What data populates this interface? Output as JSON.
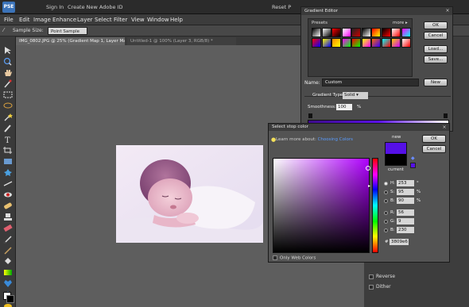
{
  "title_bar": {
    "logo": "PSE",
    "sign_in": "Sign In",
    "create_id": "Create New Adobe ID",
    "reset": "Reset P"
  },
  "menu": [
    "File",
    "Edit",
    "Image",
    "Enhance",
    "Layer",
    "Select",
    "Filter",
    "View",
    "Window",
    "Help"
  ],
  "options": {
    "sample_size_label": "Sample Size:",
    "sample_size_value": "Point Sample"
  },
  "tabs": [
    "IMG_0802.JPG @ 25% (Gradient Map 1, Layer Mask/8) *",
    "Untitled-1 @ 100% (Layer 3, RGB/8) *"
  ],
  "gradient_editor": {
    "title": "Gradient Editor",
    "presets_label": "Presets",
    "more_label": "more",
    "ok": "OK",
    "cancel": "Cancel",
    "load": "Load...",
    "save": "Save...",
    "name_label": "Name:",
    "name_value": "Custom",
    "new": "New",
    "gradient_type_label": "Gradient Type:",
    "gradient_type_value": "Solid",
    "smoothness_label": "Smoothness:",
    "smoothness_value": "100",
    "smoothness_unit": "%",
    "preset_colors": [
      [
        "#000000",
        "#ffffff"
      ],
      [
        "#ffffff",
        "#000000"
      ],
      [
        "#ff0000",
        "#000000"
      ],
      [
        "#ffffff",
        "#ff00ff"
      ],
      [
        "#222222",
        "#cc0000"
      ],
      [
        "#000000",
        "#ffffff"
      ],
      [
        "#ff0000",
        "#ffff00"
      ],
      [
        "#000000",
        "#ff0000"
      ],
      [
        "#ffffff",
        "#ff0000"
      ],
      [
        "#ff00ff",
        "#00ffff"
      ],
      [
        "#ff0000",
        "#0000ff"
      ],
      [
        "#ffff00",
        "#0000ff"
      ],
      [
        "#ff8800",
        "#ffff00"
      ],
      [
        "#ff00ff",
        "#00ff00"
      ],
      [
        "#ff0000",
        "#00ff00"
      ],
      [
        "#ffff00",
        "#ff00ff"
      ],
      [
        "#ff6600",
        "#3300ff"
      ],
      [
        "#00ffff",
        "#ff0000"
      ],
      [
        "#ffcc00",
        "#cc00ff"
      ],
      [
        "#ffffff",
        "#ff0000"
      ]
    ]
  },
  "select_stop_color": {
    "title": "Select stop color",
    "learn_prefix": "Learn more about:",
    "learn_link": "Choosing Colors",
    "new_label": "new",
    "current_label": "current",
    "ok": "OK",
    "cancel": "Cancel",
    "fields": [
      {
        "label": "H:",
        "value": "253",
        "unit": "°",
        "selected": true
      },
      {
        "label": "S:",
        "value": "95",
        "unit": "%",
        "selected": false
      },
      {
        "label": "B:",
        "value": "90",
        "unit": "%",
        "selected": false
      },
      {
        "label": "R:",
        "value": "56",
        "unit": "",
        "selected": false
      },
      {
        "label": "G:",
        "value": "9",
        "unit": "",
        "selected": false
      },
      {
        "label": "B:",
        "value": "230",
        "unit": "",
        "selected": false
      }
    ],
    "hex_label": "#",
    "hex_value": "3809e6",
    "only_web": "Only Web Colors"
  },
  "right_panel": {
    "dither": "Dither",
    "reverse": "Reverse"
  }
}
